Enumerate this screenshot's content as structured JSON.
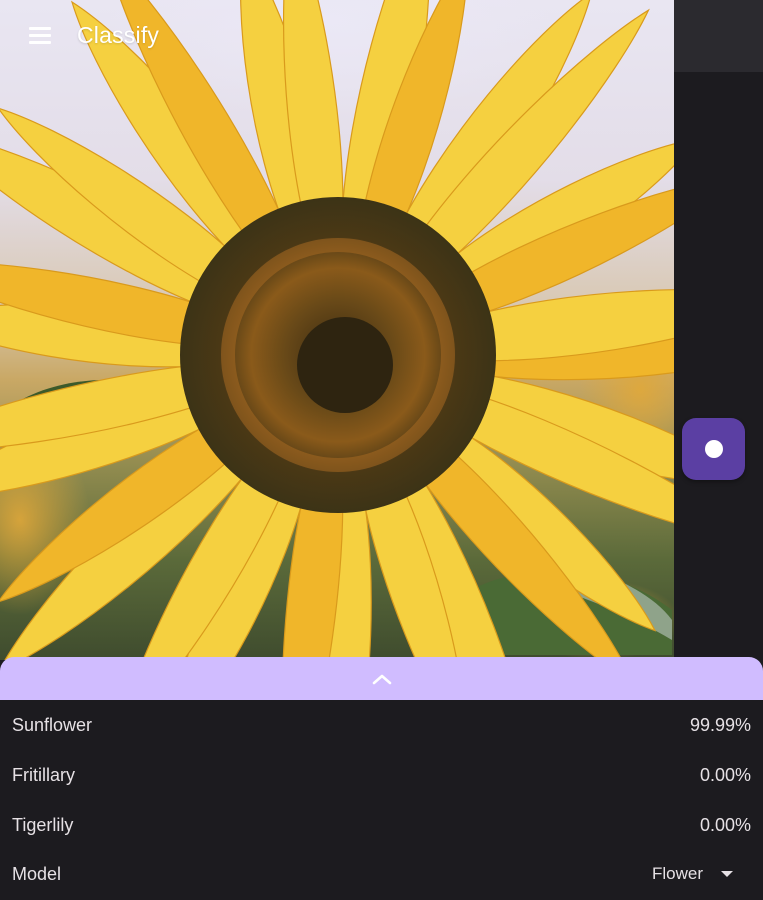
{
  "app_bar": {
    "title": "Classify",
    "menu_icon": "hamburger-menu-icon"
  },
  "camera": {
    "capture_icon": "capture-dot-icon",
    "accent": "#5b3fa3"
  },
  "sheet": {
    "handle_color": "#d0bcff",
    "expand_icon": "chevron-up-icon"
  },
  "results": [
    {
      "label": "Sunflower",
      "score": "99.99%"
    },
    {
      "label": "Fritillary",
      "score": "0.00%"
    },
    {
      "label": "Tigerlily",
      "score": "0.00%"
    }
  ],
  "model": {
    "label": "Model",
    "selected": "Flower",
    "dropdown_icon": "caret-down-icon"
  }
}
